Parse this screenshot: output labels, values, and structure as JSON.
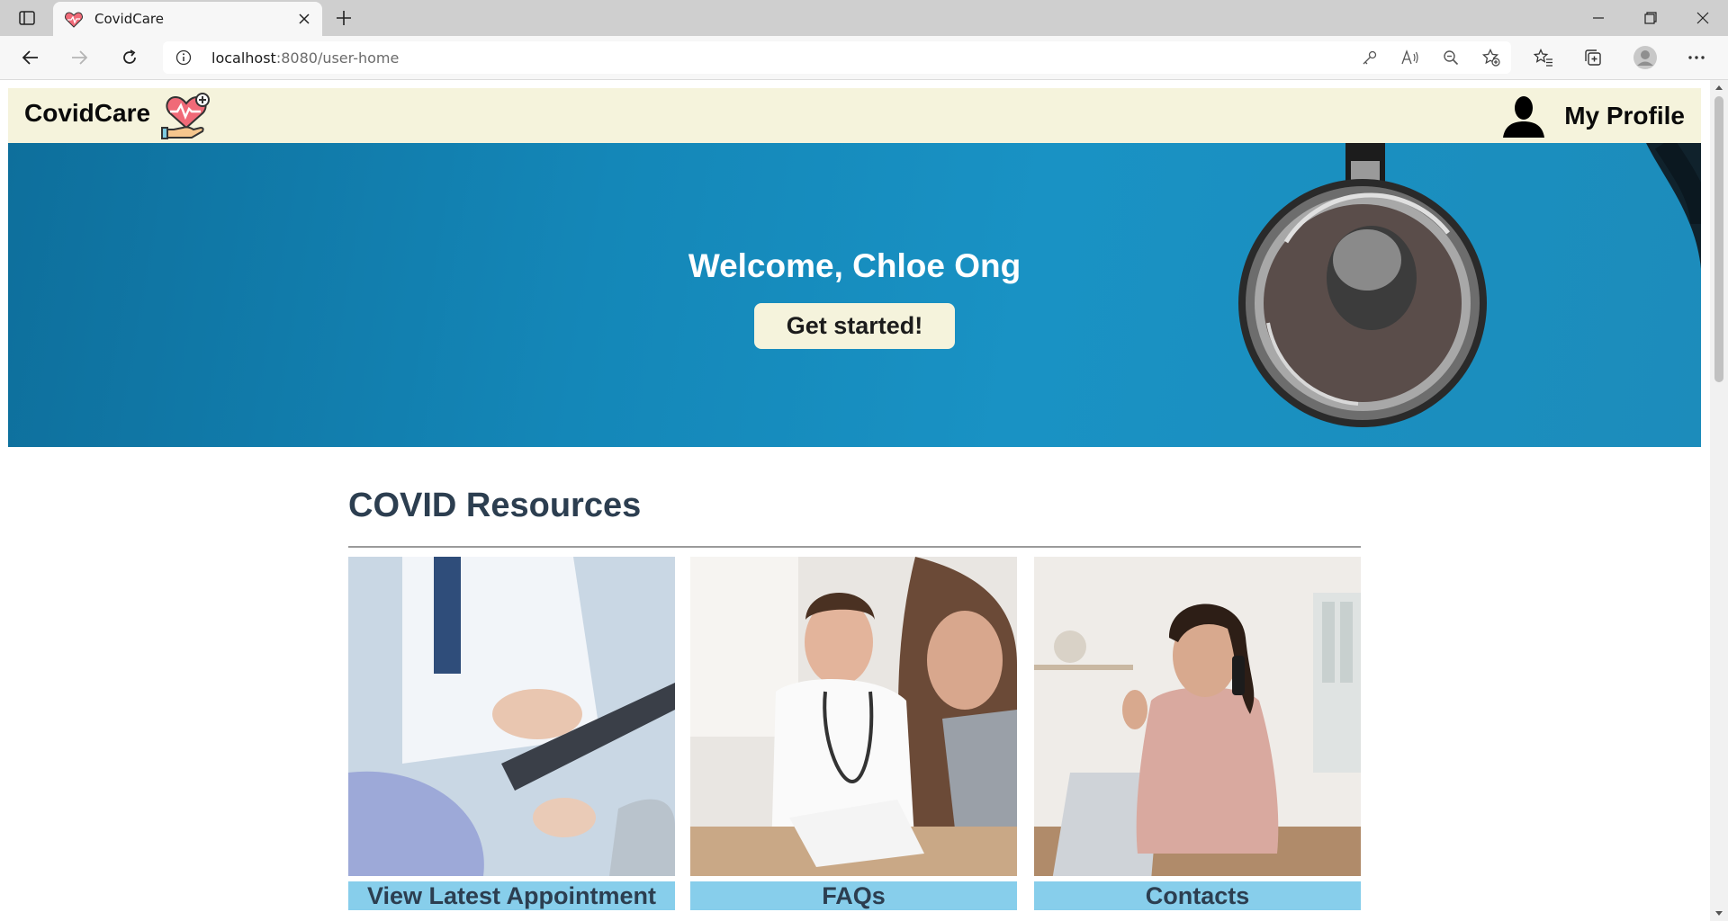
{
  "browser": {
    "tab_title": "CovidCare",
    "url_host": "localhost",
    "url_path": ":8080/user-home"
  },
  "header": {
    "brand": "CovidCare",
    "profile_label": "My Profile"
  },
  "hero": {
    "welcome_text": "Welcome, Chloe Ong",
    "cta_label": "Get started!"
  },
  "resources": {
    "title": "COVID Resources",
    "cards": [
      {
        "label": "View Latest Appointment"
      },
      {
        "label": "FAQs"
      },
      {
        "label": "Contacts"
      }
    ]
  },
  "colors": {
    "header_bg": "#f5f3dc",
    "hero_blue": "#1487b8",
    "card_label_bg": "#87ceeb",
    "heading_text": "#2c3e50"
  }
}
